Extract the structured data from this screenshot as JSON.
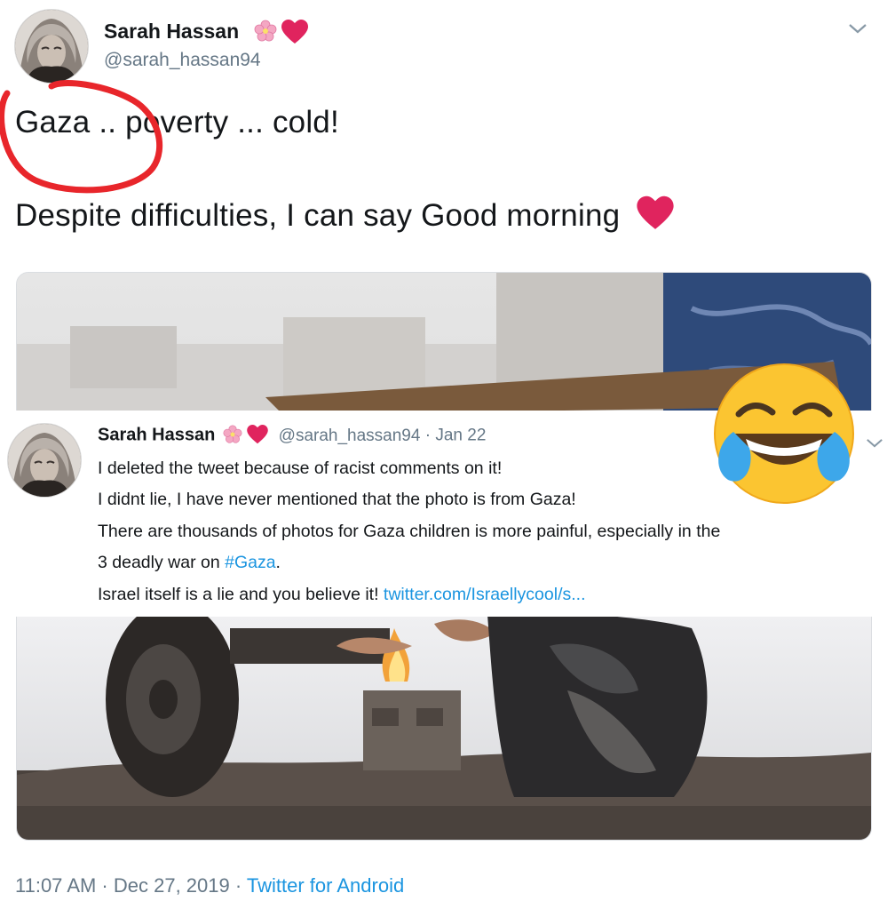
{
  "tweet": {
    "author_name": "Sarah Hassan",
    "author_handle": "@sarah_hassan94",
    "name_emoji": [
      "cherry-blossom",
      "red-heart"
    ],
    "line1": "Gaza .. poverty ... cold!",
    "line2": "Despite difficulties, I can say Good morning",
    "timestamp": "11:07 AM · Dec 27, 2019 · ",
    "source": "Twitter for Android"
  },
  "quoted_tweet": {
    "author_name": "Sarah Hassan",
    "author_handle": "@sarah_hassan94",
    "date_sep": " · ",
    "date": "Jan 22",
    "lines": [
      "I deleted the tweet because of racist comments on it!",
      "I didnt lie, I have never mentioned that the photo is from Gaza!",
      "There are thousands of photos for Gaza children is more painful, especially in the",
      "3 deadly war on "
    ],
    "hashtag": "#Gaza",
    "hashtag_after": ".",
    "last_line_prefix": "Israel itself is a lie and you believe it! ",
    "link": "twitter.com/Israellycool/s..."
  },
  "colors": {
    "accent": "#1b95e0",
    "muted": "#657786",
    "heart": "#e0245e",
    "annotation": "#e8262b"
  }
}
